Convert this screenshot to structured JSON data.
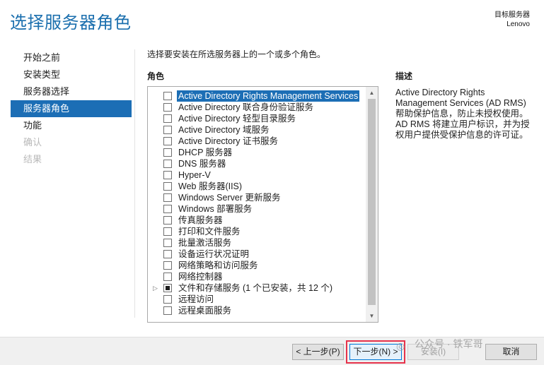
{
  "header": {
    "title": "选择服务器角色",
    "target_label": "目标服务器",
    "target_value": "Lenovo"
  },
  "nav": {
    "items": [
      {
        "label": "开始之前",
        "state": "normal"
      },
      {
        "label": "安装类型",
        "state": "normal"
      },
      {
        "label": "服务器选择",
        "state": "normal"
      },
      {
        "label": "服务器角色",
        "state": "active"
      },
      {
        "label": "功能",
        "state": "normal"
      },
      {
        "label": "确认",
        "state": "disabled"
      },
      {
        "label": "结果",
        "state": "disabled"
      }
    ]
  },
  "main": {
    "instruction": "选择要安装在所选服务器上的一个或多个角色。",
    "roles_header": "角色",
    "roles": [
      {
        "label": "Active Directory Rights Management Services",
        "checked": false,
        "selected": true
      },
      {
        "label": "Active Directory 联合身份验证服务",
        "checked": false
      },
      {
        "label": "Active Directory 轻型目录服务",
        "checked": false
      },
      {
        "label": "Active Directory 域服务",
        "checked": false
      },
      {
        "label": "Active Directory 证书服务",
        "checked": false
      },
      {
        "label": "DHCP 服务器",
        "checked": false
      },
      {
        "label": "DNS 服务器",
        "checked": false
      },
      {
        "label": "Hyper-V",
        "checked": false
      },
      {
        "label": "Web 服务器(IIS)",
        "checked": false
      },
      {
        "label": "Windows Server 更新服务",
        "checked": false
      },
      {
        "label": "Windows 部署服务",
        "checked": false
      },
      {
        "label": "传真服务器",
        "checked": false
      },
      {
        "label": "打印和文件服务",
        "checked": false
      },
      {
        "label": "批量激活服务",
        "checked": false
      },
      {
        "label": "设备运行状况证明",
        "checked": false
      },
      {
        "label": "网络策略和访问服务",
        "checked": false
      },
      {
        "label": "网络控制器",
        "checked": false
      },
      {
        "label": "文件和存储服务 (1 个已安装，共 12 个)",
        "checked": "partial",
        "expandable": true
      },
      {
        "label": "远程访问",
        "checked": false
      },
      {
        "label": "远程桌面服务",
        "checked": false
      }
    ],
    "description_header": "描述",
    "description": [
      "Active Directory Rights Management Services (AD RMS) 帮助保护信息，防止未授权使用。",
      "AD RMS 将建立用户标识，并为授权用户提供受保护信息的许可证。"
    ]
  },
  "footer": {
    "prev_label": "< 上一步(P)",
    "next_label": "下一步(N) >",
    "install_label": "安装(I)",
    "cancel_label": "取消"
  },
  "watermark": {
    "text": "公众号 · 铁军哥"
  },
  "colors": {
    "title": "#1b6fae",
    "accent": "#1c6eb5",
    "highlight_frame": "#e6324b"
  },
  "icons": {
    "expander": "triangle-right-icon",
    "scroll_up": "arrow-up-icon",
    "scroll_down": "arrow-down-icon",
    "watermark": "wechat-icon"
  }
}
